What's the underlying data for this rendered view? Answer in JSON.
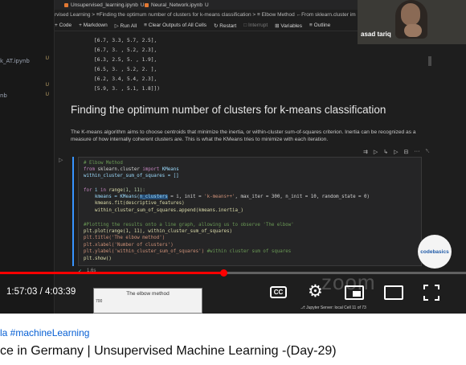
{
  "explorer": {
    "files": [
      {
        "name": "k_AT.ipynb",
        "top": 0
      },
      {
        "name": "nb",
        "top": 0
      }
    ],
    "badges": [
      "U",
      "U",
      "U"
    ]
  },
  "tabs": [
    {
      "label": "Unsupervised_learning.ipynb",
      "badge": "U"
    },
    {
      "label": "Neural_Network.ipynb",
      "badge": "U"
    }
  ],
  "breadcrumb": "rvised Learning > ≡Finding the optimum number of clusters for k-means classification > ≡ Elbow Method ←From sklearn.cluster im",
  "toolbar": {
    "code": "+ Code",
    "markdown": "+ Markdown",
    "run_all": "▷ Run All",
    "clear": "≡ Clear Outputs of All Cells",
    "restart": "↻ Restart",
    "interrupt": "□ Interrupt",
    "variables": "⊞ Variables",
    "outline": "≡ Outline"
  },
  "output_lines": [
    "[6.7, 3.3, 5.7, 2.5],",
    "[6.7, 3. , 5.2, 2.3],",
    "[6.3, 2.5, 5. , 1.9],",
    "[6.5, 3. , 5.2, 2. ],",
    "[6.2, 3.4, 5.4, 2.3],",
    "[5.9, 3. , 5.1, 1.8]])"
  ],
  "heading": "Finding the optimum number of clusters for k-means classification",
  "paragraph": "The K-means algorithm aims to choose centroids that minimize the inertia, or within-cluster sum-of-squares criterion. Inertia can be recognized as a measure of how internally coherent clusters are. This is what the KMeans tries to minimize with each iteration.",
  "cell_toolbar": [
    "⇉",
    "▷",
    "↳",
    "▷",
    "⊟",
    "···",
    "␡"
  ],
  "code": {
    "l1": "# Elbow Method",
    "l2a": "from",
    "l2b": " sklearn.cluster ",
    "l2c": "import",
    "l2d": " KMeans",
    "l3": "within_cluster_sum_of_squares = []",
    "l4a": "for",
    "l4b": " i ",
    "l4c": "in",
    "l4d": " range",
    "l4e": "(1, 11):",
    "l5a": "    kmeans = KMeans(",
    "l5b": "n_clusters",
    "l5c": " = i, init = ",
    "l5d": "'k-means++'",
    "l5e": ", max_iter = 300, n_init = 10, random_state = 0)",
    "l6": "    kmeans.fit(descriptive_features)",
    "l7": "    within_cluster_sum_of_squares.append(kmeans.inertia_)",
    "l8": "#Plotting the results onto a line graph, allowing us to observe 'The elbow'",
    "l9": "plt.plot(range(1, 11), within_cluster_sum_of_squares)",
    "l10": "plt.title('The elbow method')",
    "l11": "plt.xlabel('Number of clusters')",
    "l12a": "plt.ylabel('within_cluster_sum_of_squares')",
    "l12b": " #within cluster sum of squares",
    "l13": "plt.show()"
  },
  "exec": {
    "check": "✓",
    "time": "1.6s"
  },
  "webcam": {
    "name": "asad tariq"
  },
  "logo": "codebasics",
  "watermark": "zoom",
  "player": {
    "current_time": "1:57:03",
    "duration": "4:03:39",
    "time_text": "1:57:03 / 4:03:39",
    "progress": 0.48,
    "thumb_title": "The elbow method",
    "thumb_axis": "700",
    "cc": "CC"
  },
  "status_bar": "⎇ Jupyter Server: local   Cell 11 of 73",
  "hashtags": "la #machineLearning",
  "video_title": "ce in Germany | Unsupervised Machine Learning -(Day-29)",
  "colors": {
    "progress": "#ff0000",
    "link": "#065fd4",
    "cell_border": "#3794ff"
  }
}
